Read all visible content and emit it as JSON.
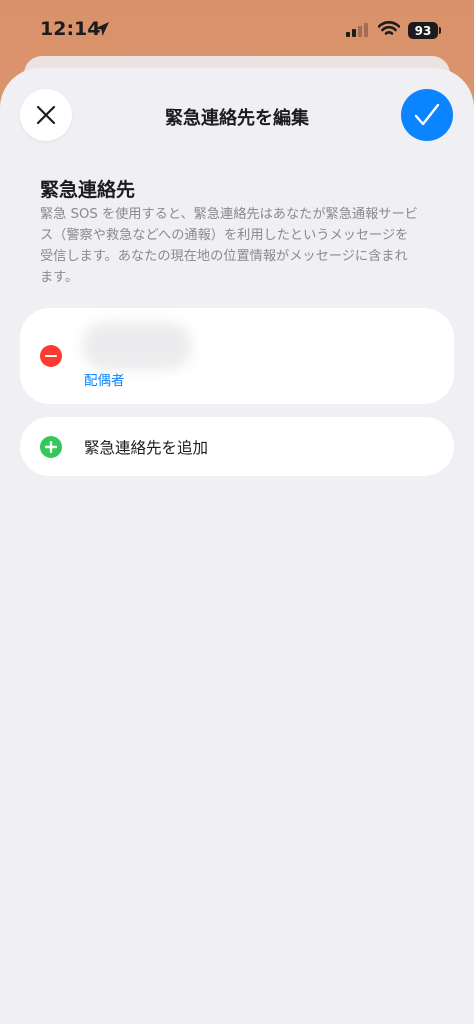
{
  "status_bar": {
    "time": "12:14",
    "battery": "93"
  },
  "nav": {
    "title": "緊急連絡先を編集",
    "close_icon": "close-icon",
    "done_icon": "checkmark-icon"
  },
  "section": {
    "title": "緊急連絡先",
    "description": "緊急 SOS を使用すると、緊急連絡先はあなたが緊急通報サービス（警察や救急などへの通報）を利用したというメッセージを受信します。あなたの現在地の位置情報がメッセージに含まれます。"
  },
  "contacts": [
    {
      "relation": "配偶者"
    }
  ],
  "add_contact": {
    "label": "緊急連絡先を追加"
  },
  "colors": {
    "accent": "#0a84ff",
    "remove": "#ff3b30",
    "add": "#34c759",
    "background": "#f0eff4"
  }
}
